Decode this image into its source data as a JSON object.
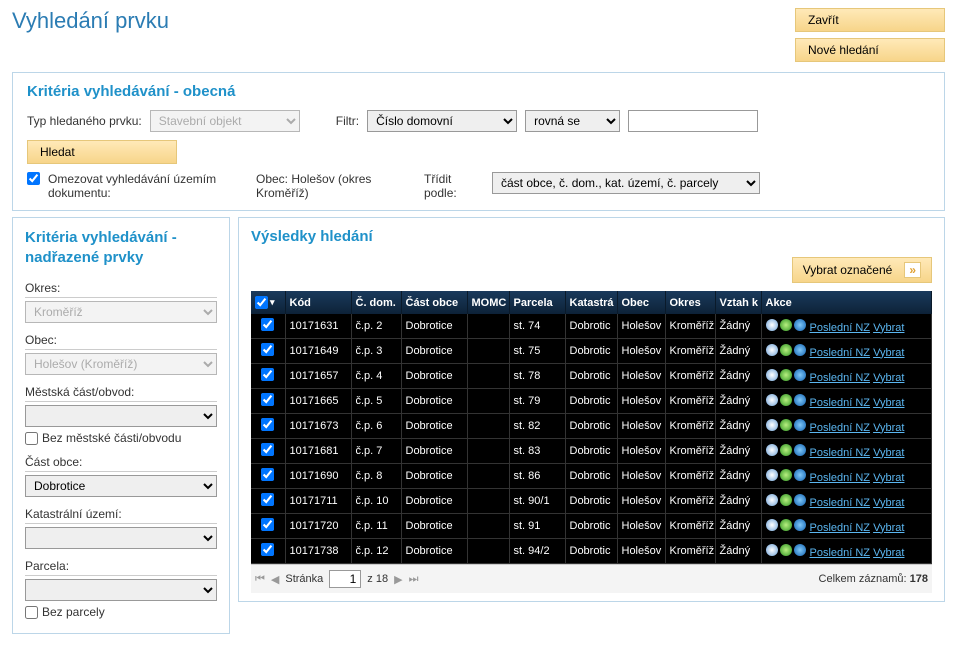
{
  "title": "Vyhledání prvku",
  "buttons": {
    "close": "Zavřít",
    "new_search": "Nové hledání",
    "search": "Hledat",
    "select_marked": "Vybrat označené"
  },
  "criteria": {
    "header": "Kritéria vyhledávání - obecná",
    "type_label": "Typ hledaného prvku:",
    "type_value": "Stavební objekt",
    "filter_label": "Filtr:",
    "filter_field": "Číslo domovní",
    "filter_op": "rovná se",
    "limit_label": "Omezovat vyhledávání územím dokumentu:",
    "obec_label": "Obec: Holešov (okres Kroměříž)",
    "sort_label": "Třídit podle:",
    "sort_value": "část obce, č. dom., kat. území, č. parcely"
  },
  "left": {
    "header": "Kritéria vyhledávání - nadřazené prvky",
    "okres_label": "Okres:",
    "okres_value": "Kroměříž",
    "obec_label": "Obec:",
    "obec_value": "Holešov (Kroměříž)",
    "mcast_label": "Městská část/obvod:",
    "mcast_chk": "Bez městské části/obvodu",
    "cobce_label": "Část obce:",
    "cobce_value": "Dobrotice",
    "ku_label": "Katastrální území:",
    "parcela_label": "Parcela:",
    "parcela_chk": "Bez parcely"
  },
  "results": {
    "header": "Výsledky hledání",
    "columns": [
      "",
      "Kód",
      "Č. dom.",
      "Část obce",
      "MOMC",
      "Parcela",
      "Katastrá",
      "Obec",
      "Okres",
      "Vztah k",
      "Akce"
    ],
    "link_nz": "Poslední NZ",
    "link_vybrat": "Vybrat",
    "rows": [
      {
        "kod": "10171631",
        "cd": "č.p. 2",
        "cobce": "Dobrotice",
        "momc": "",
        "parcela": "st. 74",
        "ku": "Dobrotic",
        "obec": "Holešov",
        "okres": "Kroměříž",
        "vztah": "Žádný"
      },
      {
        "kod": "10171649",
        "cd": "č.p. 3",
        "cobce": "Dobrotice",
        "momc": "",
        "parcela": "st. 75",
        "ku": "Dobrotic",
        "obec": "Holešov",
        "okres": "Kroměříž",
        "vztah": "Žádný"
      },
      {
        "kod": "10171657",
        "cd": "č.p. 4",
        "cobce": "Dobrotice",
        "momc": "",
        "parcela": "st. 78",
        "ku": "Dobrotic",
        "obec": "Holešov",
        "okres": "Kroměříž",
        "vztah": "Žádný"
      },
      {
        "kod": "10171665",
        "cd": "č.p. 5",
        "cobce": "Dobrotice",
        "momc": "",
        "parcela": "st. 79",
        "ku": "Dobrotic",
        "obec": "Holešov",
        "okres": "Kroměříž",
        "vztah": "Žádný"
      },
      {
        "kod": "10171673",
        "cd": "č.p. 6",
        "cobce": "Dobrotice",
        "momc": "",
        "parcela": "st. 82",
        "ku": "Dobrotic",
        "obec": "Holešov",
        "okres": "Kroměříž",
        "vztah": "Žádný"
      },
      {
        "kod": "10171681",
        "cd": "č.p. 7",
        "cobce": "Dobrotice",
        "momc": "",
        "parcela": "st. 83",
        "ku": "Dobrotic",
        "obec": "Holešov",
        "okres": "Kroměříž",
        "vztah": "Žádný"
      },
      {
        "kod": "10171690",
        "cd": "č.p. 8",
        "cobce": "Dobrotice",
        "momc": "",
        "parcela": "st. 86",
        "ku": "Dobrotic",
        "obec": "Holešov",
        "okres": "Kroměříž",
        "vztah": "Žádný"
      },
      {
        "kod": "10171711",
        "cd": "č.p. 10",
        "cobce": "Dobrotice",
        "momc": "",
        "parcela": "st. 90/1",
        "ku": "Dobrotic",
        "obec": "Holešov",
        "okres": "Kroměříž",
        "vztah": "Žádný"
      },
      {
        "kod": "10171720",
        "cd": "č.p. 11",
        "cobce": "Dobrotice",
        "momc": "",
        "parcela": "st. 91",
        "ku": "Dobrotic",
        "obec": "Holešov",
        "okres": "Kroměříž",
        "vztah": "Žádný"
      },
      {
        "kod": "10171738",
        "cd": "č.p. 12",
        "cobce": "Dobrotice",
        "momc": "",
        "parcela": "st. 94/2",
        "ku": "Dobrotic",
        "obec": "Holešov",
        "okres": "Kroměříž",
        "vztah": "Žádný"
      }
    ],
    "pager": {
      "label": "Stránka",
      "page": "1",
      "of": "z 18",
      "total_label": "Celkem záznamů:",
      "total": "178"
    }
  }
}
